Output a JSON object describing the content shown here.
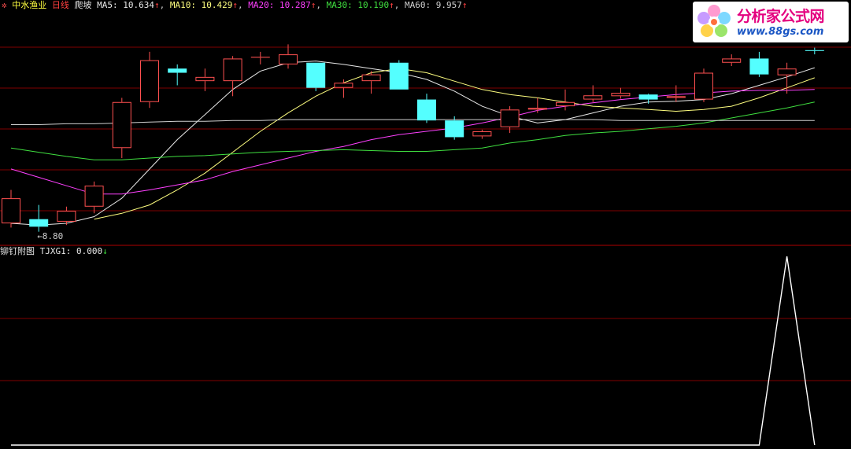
{
  "header": {
    "stock_name": "中水渔业",
    "period": "日线",
    "indicator_name": "爬坡",
    "ma": [
      {
        "label": "MA5:",
        "value": "10.634",
        "arrow": "↑",
        "color": "#e8e8e8"
      },
      {
        "label": "MA10:",
        "value": "10.429",
        "arrow": "↑",
        "color": "#ffff80"
      },
      {
        "label": "MA20:",
        "value": "10.287",
        "arrow": "↑",
        "color": "#ff40ff"
      },
      {
        "label": "MA30:",
        "value": "10.190",
        "arrow": "↑",
        "color": "#40e040"
      },
      {
        "label": "MA60:",
        "value": "9.957",
        "arrow": "↑",
        "color": "#d0d0d0"
      }
    ]
  },
  "low_label": "←8.80",
  "sub": {
    "name": "铆钉附图",
    "indicator": "TJXG1:",
    "value": "0.000",
    "arrow": "↓"
  },
  "logo": {
    "text": "分析家公式网",
    "url": "www.88gs.com"
  },
  "colors": {
    "up": "#ff5050",
    "down": "#54ffff",
    "grid": "#800000",
    "separator": "#b00000"
  },
  "chart_data": [
    {
      "type": "candlestick",
      "title": "中水渔业 日线",
      "candles": [
        {
          "o": 8.9,
          "h": 9.3,
          "l": 8.85,
          "c": 9.2
        },
        {
          "o": 8.95,
          "h": 9.12,
          "l": 8.8,
          "c": 8.86
        },
        {
          "o": 8.92,
          "h": 9.1,
          "l": 8.88,
          "c": 9.05
        },
        {
          "o": 9.1,
          "h": 9.4,
          "l": 9.02,
          "c": 9.35
        },
        {
          "o": 9.8,
          "h": 10.4,
          "l": 9.68,
          "c": 10.35
        },
        {
          "o": 10.35,
          "h": 10.95,
          "l": 10.28,
          "c": 10.85
        },
        {
          "o": 10.75,
          "h": 10.8,
          "l": 10.55,
          "c": 10.7
        },
        {
          "o": 10.6,
          "h": 10.75,
          "l": 10.48,
          "c": 10.65
        },
        {
          "o": 10.6,
          "h": 10.9,
          "l": 10.42,
          "c": 10.87
        },
        {
          "o": 10.88,
          "h": 10.95,
          "l": 10.8,
          "c": 10.89
        },
        {
          "o": 10.8,
          "h": 11.04,
          "l": 10.75,
          "c": 10.92
        },
        {
          "o": 10.82,
          "h": 10.82,
          "l": 10.48,
          "c": 10.52
        },
        {
          "o": 10.52,
          "h": 10.62,
          "l": 10.4,
          "c": 10.58
        },
        {
          "o": 10.6,
          "h": 10.72,
          "l": 10.45,
          "c": 10.68
        },
        {
          "o": 10.82,
          "h": 10.85,
          "l": 10.5,
          "c": 10.5
        },
        {
          "o": 10.38,
          "h": 10.45,
          "l": 10.1,
          "c": 10.13
        },
        {
          "o": 10.13,
          "h": 10.18,
          "l": 9.9,
          "c": 9.93
        },
        {
          "o": 9.94,
          "h": 10.02,
          "l": 9.91,
          "c": 10.0
        },
        {
          "o": 10.05,
          "h": 10.3,
          "l": 9.98,
          "c": 10.26
        },
        {
          "o": 10.26,
          "h": 10.4,
          "l": 10.22,
          "c": 10.28
        },
        {
          "o": 10.3,
          "h": 10.5,
          "l": 10.25,
          "c": 10.35
        },
        {
          "o": 10.38,
          "h": 10.55,
          "l": 10.35,
          "c": 10.43
        },
        {
          "o": 10.42,
          "h": 10.52,
          "l": 10.39,
          "c": 10.46
        },
        {
          "o": 10.44,
          "h": 10.45,
          "l": 10.33,
          "c": 10.38
        },
        {
          "o": 10.4,
          "h": 10.55,
          "l": 10.35,
          "c": 10.42
        },
        {
          "o": 10.38,
          "h": 10.75,
          "l": 10.35,
          "c": 10.7
        },
        {
          "o": 10.82,
          "h": 10.92,
          "l": 10.78,
          "c": 10.87
        },
        {
          "o": 10.87,
          "h": 10.95,
          "l": 10.65,
          "c": 10.68
        },
        {
          "o": 10.67,
          "h": 10.82,
          "l": 10.45,
          "c": 10.75
        },
        {
          "o": 10.97,
          "h": 11.0,
          "l": 10.92,
          "c": 10.96
        }
      ],
      "ma_series": [
        {
          "name": "MA5",
          "color": "#e8e8e8",
          "values": [
            8.9,
            8.88,
            8.9,
            8.98,
            9.2,
            9.55,
            9.9,
            10.2,
            10.5,
            10.72,
            10.82,
            10.84,
            10.8,
            10.75,
            10.7,
            10.62,
            10.48,
            10.3,
            10.18,
            10.1,
            10.14,
            10.22,
            10.3,
            10.35,
            10.36,
            10.38,
            10.45,
            10.55,
            10.65,
            10.76
          ]
        },
        {
          "name": "MA10",
          "color": "#ffff80",
          "values": [
            null,
            null,
            null,
            8.95,
            9.02,
            9.12,
            9.3,
            9.5,
            9.75,
            10.0,
            10.22,
            10.42,
            10.58,
            10.7,
            10.75,
            10.7,
            10.6,
            10.5,
            10.44,
            10.4,
            10.35,
            10.3,
            10.28,
            10.26,
            10.24,
            10.26,
            10.3,
            10.4,
            10.52,
            10.64
          ]
        },
        {
          "name": "MA20",
          "color": "#ff40ff",
          "values": [
            9.55,
            9.45,
            9.35,
            9.25,
            9.25,
            9.3,
            9.36,
            9.42,
            9.52,
            9.6,
            9.68,
            9.76,
            9.82,
            9.9,
            9.96,
            10.0,
            10.04,
            10.1,
            10.17,
            10.25,
            10.3,
            10.34,
            10.38,
            10.41,
            10.44,
            10.46,
            10.48,
            10.49,
            10.49,
            10.5
          ]
        },
        {
          "name": "MA30",
          "color": "#40e040",
          "values": [
            9.8,
            9.75,
            9.7,
            9.66,
            9.66,
            9.68,
            9.7,
            9.71,
            9.73,
            9.75,
            9.76,
            9.77,
            9.78,
            9.77,
            9.76,
            9.76,
            9.78,
            9.8,
            9.86,
            9.9,
            9.95,
            9.98,
            10.0,
            10.03,
            10.06,
            10.1,
            10.16,
            10.22,
            10.28,
            10.35
          ]
        },
        {
          "name": "MA60",
          "color": "#d0d0d0",
          "values": [
            10.08,
            10.08,
            10.09,
            10.09,
            10.1,
            10.11,
            10.12,
            10.12,
            10.13,
            10.13,
            10.14,
            10.14,
            10.14,
            10.14,
            10.14,
            10.14,
            10.14,
            10.14,
            10.14,
            10.14,
            10.14,
            10.14,
            10.13,
            10.13,
            10.13,
            10.13,
            10.13,
            10.13,
            10.13,
            10.13
          ]
        }
      ],
      "ylim": [
        8.75,
        11.25
      ]
    },
    {
      "type": "line",
      "title": "铆钉附图",
      "series": [
        {
          "name": "TJXG1",
          "color": "#ffffff",
          "values": [
            0,
            0,
            0,
            0,
            0,
            0,
            0,
            0,
            0,
            0,
            0,
            0,
            0,
            0,
            0,
            0,
            0,
            0,
            0,
            0,
            0,
            0,
            0,
            0,
            0,
            0,
            0,
            0,
            1,
            0
          ]
        }
      ],
      "ylim": [
        0,
        1
      ]
    }
  ]
}
